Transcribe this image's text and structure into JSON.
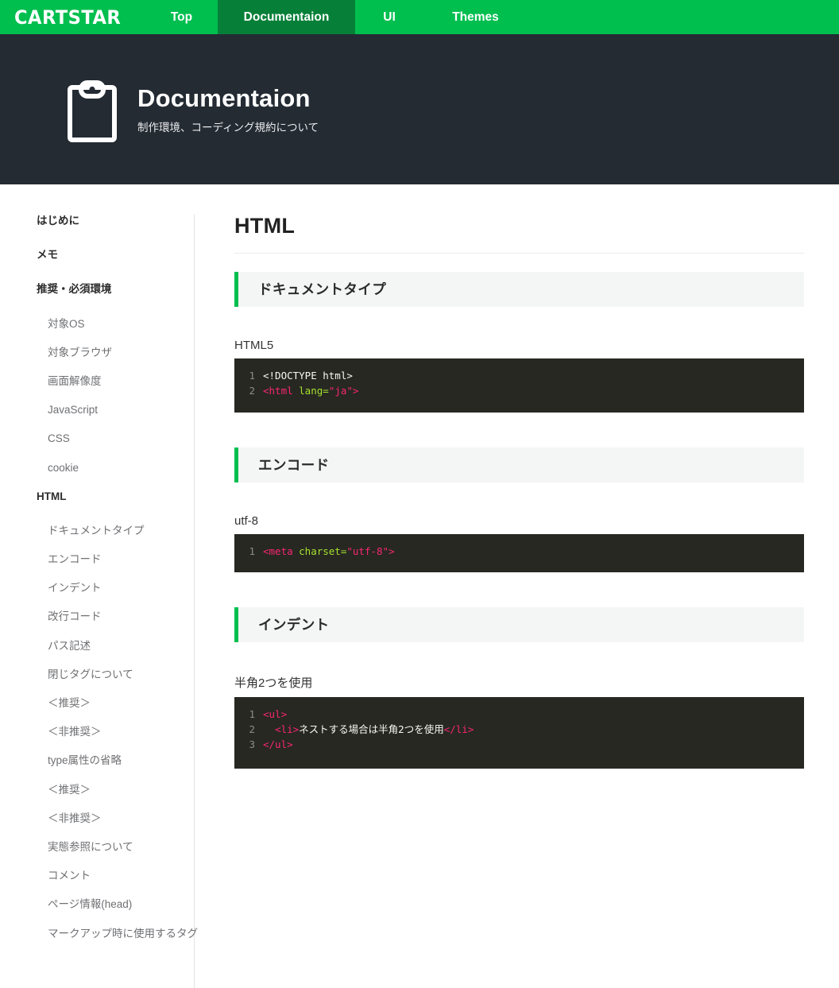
{
  "navbar": {
    "brand": "CARTSTAR",
    "items": [
      {
        "label": "Top",
        "active": false
      },
      {
        "label": "Documentaion",
        "active": true
      },
      {
        "label": "UI",
        "active": false
      },
      {
        "label": "Themes",
        "active": false
      }
    ]
  },
  "hero": {
    "icon": "clipboard-icon",
    "title": "Documentaion",
    "subtitle": "制作環境、コーディング規約について"
  },
  "sidebar": {
    "items": [
      {
        "label": "はじめに",
        "level": 1
      },
      {
        "label": "メモ",
        "level": 1
      },
      {
        "label": "推奨・必須環境",
        "level": 1
      },
      {
        "label": "対象OS",
        "level": 2
      },
      {
        "label": "対象ブラウザ",
        "level": 2
      },
      {
        "label": "画面解像度",
        "level": 2
      },
      {
        "label": "JavaScript",
        "level": 2
      },
      {
        "label": "CSS",
        "level": 2
      },
      {
        "label": "cookie",
        "level": 2
      },
      {
        "label": "HTML",
        "level": 1
      },
      {
        "label": "ドキュメントタイプ",
        "level": 2
      },
      {
        "label": "エンコード",
        "level": 2
      },
      {
        "label": "インデント",
        "level": 2
      },
      {
        "label": "改行コード",
        "level": 2
      },
      {
        "label": "パス記述",
        "level": 2
      },
      {
        "label": "閉じタグについて",
        "level": 2
      },
      {
        "label": "＜推奨＞",
        "level": 2
      },
      {
        "label": "＜非推奨＞",
        "level": 2
      },
      {
        "label": "type属性の省略",
        "level": 2
      },
      {
        "label": "＜推奨＞",
        "level": 2
      },
      {
        "label": "＜非推奨＞",
        "level": 2
      },
      {
        "label": "実態参照について",
        "level": 2
      },
      {
        "label": "コメント",
        "level": 2
      },
      {
        "label": "ページ情報(head)",
        "level": 2
      },
      {
        "label": "マークアップ時に使用するタグ",
        "level": 2
      }
    ]
  },
  "main": {
    "title": "HTML",
    "sections": [
      {
        "heading": "ドキュメントタイプ",
        "caption": "HTML5",
        "code": [
          {
            "num": "1",
            "parts": [
              {
                "t": "<!DOCTYPE html>",
                "c": "tok-plain"
              }
            ]
          },
          {
            "num": "2",
            "parts": [
              {
                "t": "<html ",
                "c": "tok-tag"
              },
              {
                "t": "lang=",
                "c": "tok-attr"
              },
              {
                "t": "\"ja\"",
                "c": "tok-str"
              },
              {
                "t": ">",
                "c": "tok-tag"
              }
            ]
          }
        ]
      },
      {
        "heading": "エンコード",
        "caption": "utf-8",
        "code": [
          {
            "num": "1",
            "parts": [
              {
                "t": "<meta ",
                "c": "tok-tag"
              },
              {
                "t": "charset=",
                "c": "tok-attr"
              },
              {
                "t": "\"utf-8\"",
                "c": "tok-str"
              },
              {
                "t": ">",
                "c": "tok-tag"
              }
            ]
          }
        ]
      },
      {
        "heading": "インデント",
        "caption": "半角2つを使用",
        "code": [
          {
            "num": "1",
            "parts": [
              {
                "t": "<ul>",
                "c": "tok-tag"
              }
            ]
          },
          {
            "num": "2",
            "parts": [
              {
                "t": "  ",
                "c": "tok-plain"
              },
              {
                "t": "<li>",
                "c": "tok-tag"
              },
              {
                "t": "ネストする場合は半角2つを使用",
                "c": "tok-plain"
              },
              {
                "t": "</li>",
                "c": "tok-tag"
              }
            ]
          },
          {
            "num": "3",
            "parts": [
              {
                "t": "</ul>",
                "c": "tok-tag"
              }
            ]
          }
        ]
      }
    ]
  },
  "colors": {
    "brand_green": "#00bf4f",
    "active_green": "#068038",
    "hero_dark": "#242b33",
    "section_bg": "#f4f5f5",
    "code_bg": "#272822"
  }
}
